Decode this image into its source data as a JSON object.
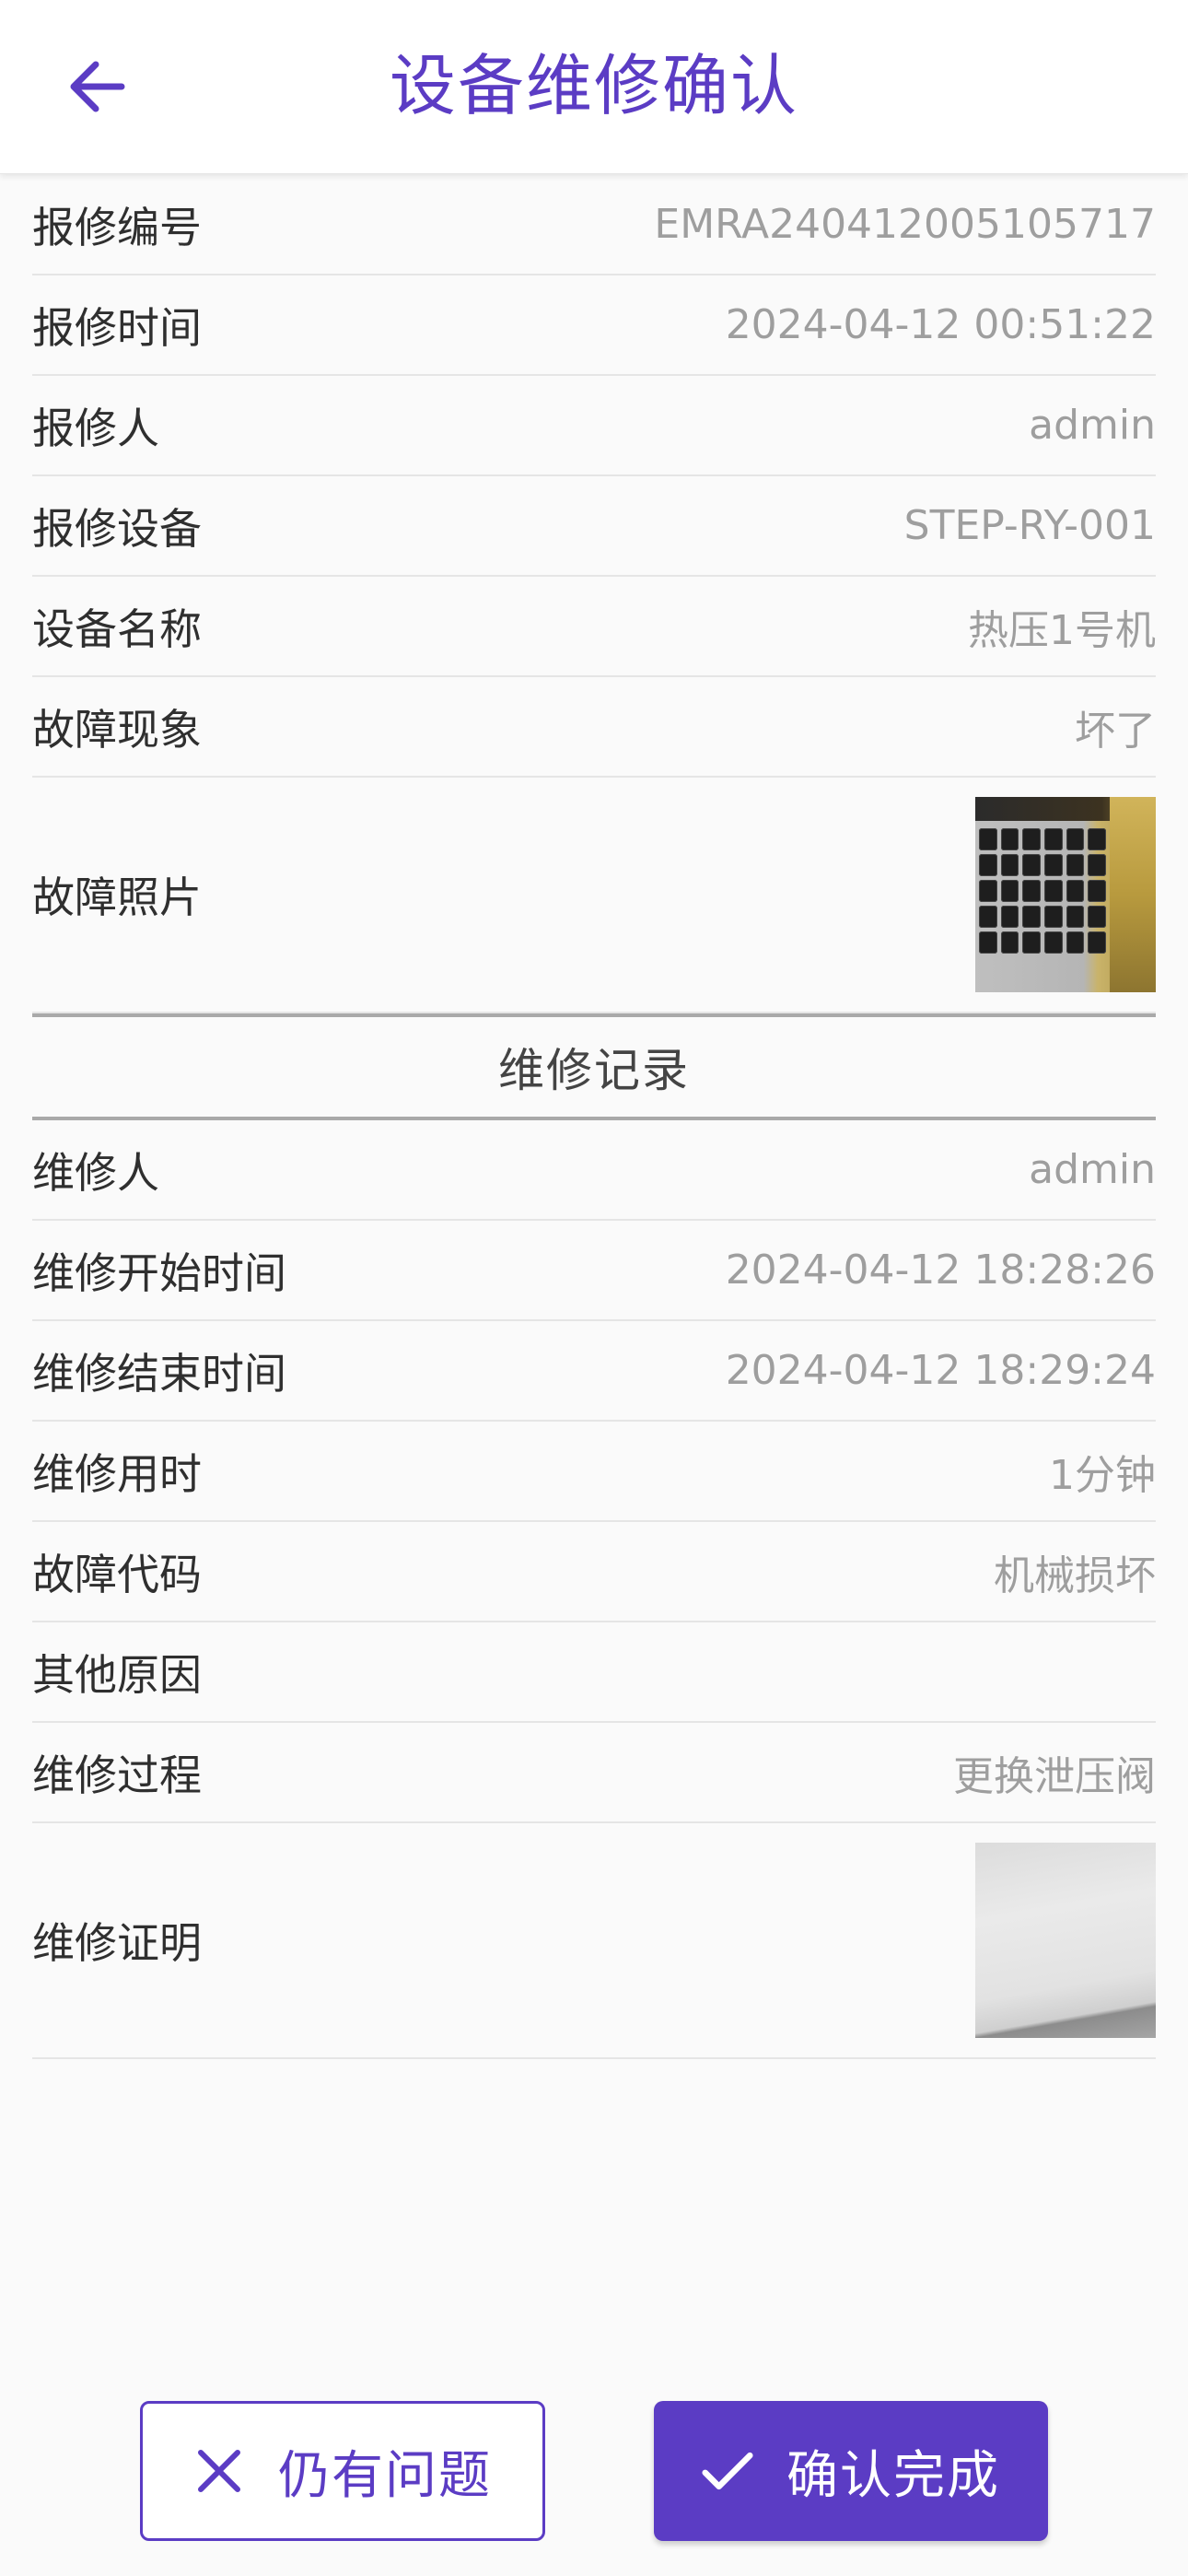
{
  "header": {
    "title": "设备维修确认",
    "back_icon": "arrow-left-icon"
  },
  "details": [
    {
      "label": "报修编号",
      "value": "EMRA240412005105717"
    },
    {
      "label": "报修时间",
      "value": "2024-04-12 00:51:22"
    },
    {
      "label": "报修人",
      "value": "admin"
    },
    {
      "label": "报修设备",
      "value": "STEP-RY-001"
    },
    {
      "label": "设备名称",
      "value": "热压1号机"
    },
    {
      "label": "故障现象",
      "value": "坏了"
    }
  ],
  "fault_photo": {
    "label": "故障照片"
  },
  "repair_section": {
    "title": "维修记录"
  },
  "repair": [
    {
      "label": "维修人",
      "value": "admin"
    },
    {
      "label": "维修开始时间",
      "value": "2024-04-12 18:28:26"
    },
    {
      "label": "维修结束时间",
      "value": "2024-04-12 18:29:24"
    },
    {
      "label": "维修用时",
      "value": "1分钟"
    },
    {
      "label": "故障代码",
      "value": "机械损坏"
    },
    {
      "label": "其他原因",
      "value": ""
    },
    {
      "label": "维修过程",
      "value": "更换泄压阀"
    }
  ],
  "repair_proof": {
    "label": "维修证明"
  },
  "actions": {
    "reject_label": "仍有问题",
    "reject_icon": "close-icon",
    "confirm_label": "确认完成",
    "confirm_icon": "check-icon"
  },
  "colors": {
    "accent": "#5b3cc4",
    "label_text": "#2f2f2f",
    "value_text": "#9e9e9e",
    "background": "#fafafa"
  }
}
